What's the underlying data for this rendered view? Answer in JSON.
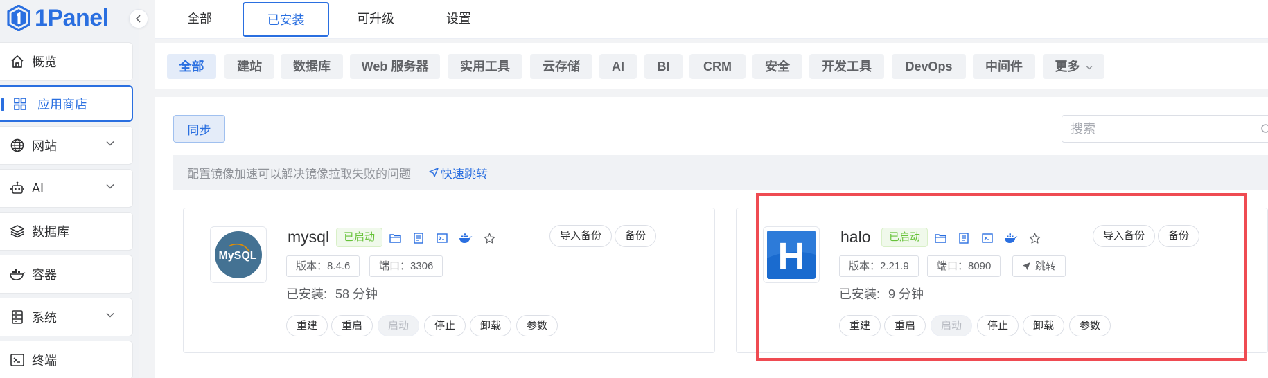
{
  "app": {
    "name": "1Panel",
    "colors": {
      "brand": "#2a6fe0",
      "success": "#67c23a",
      "highlight": "#ef4b52"
    }
  },
  "sidebar": {
    "items": [
      {
        "label": "概览",
        "icon": "home-icon"
      },
      {
        "label": "应用商店",
        "icon": "grid-icon",
        "active": true
      },
      {
        "label": "网站",
        "icon": "globe-icon",
        "expandable": true
      },
      {
        "label": "AI",
        "icon": "robot-icon",
        "expandable": true
      },
      {
        "label": "数据库",
        "icon": "layers-icon"
      },
      {
        "label": "容器",
        "icon": "docker-icon"
      },
      {
        "label": "系统",
        "icon": "server-icon",
        "expandable": true
      },
      {
        "label": "终端",
        "icon": "terminal-icon"
      }
    ]
  },
  "tabs": [
    {
      "label": "全部"
    },
    {
      "label": "已安装",
      "active": true
    },
    {
      "label": "可升级"
    },
    {
      "label": "设置"
    }
  ],
  "categories": [
    {
      "label": "全部",
      "active": true
    },
    {
      "label": "建站"
    },
    {
      "label": "数据库"
    },
    {
      "label": "Web 服务器"
    },
    {
      "label": "实用工具"
    },
    {
      "label": "云存储"
    },
    {
      "label": "AI"
    },
    {
      "label": "BI"
    },
    {
      "label": "CRM"
    },
    {
      "label": "安全"
    },
    {
      "label": "开发工具"
    },
    {
      "label": "DevOps"
    },
    {
      "label": "中间件"
    },
    {
      "label": "更多"
    }
  ],
  "toolbar": {
    "sync_label": "同步",
    "search_placeholder": "搜索"
  },
  "notice": {
    "text": "配置镜像加速可以解决镜像拉取失败的问题",
    "link_label": "快速跳转"
  },
  "apps": [
    {
      "name": "mysql",
      "status": "已启动",
      "version_label": "版本：8.4.6",
      "port_label": "端口：3306",
      "installed_label": "已安装:",
      "installed_value": "58 分钟",
      "import_backup_label": "导入备份",
      "backup_label": "备份",
      "logo_text": "MySQL",
      "actions": [
        "重建",
        "重启",
        "启动",
        "停止",
        "卸载",
        "参数"
      ]
    },
    {
      "name": "halo",
      "status": "已启动",
      "version_label": "版本：2.21.9",
      "port_label": "端口：8090",
      "jump_label": "跳转",
      "installed_label": "已安装:",
      "installed_value": "9 分钟",
      "import_backup_label": "导入备份",
      "backup_label": "备份",
      "logo_text": "H",
      "actions": [
        "重建",
        "重启",
        "启动",
        "停止",
        "卸载",
        "参数"
      ]
    }
  ]
}
